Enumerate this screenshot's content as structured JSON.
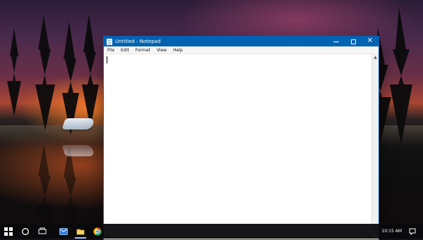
{
  "window": {
    "title": "Untitled - Notepad",
    "controls": {
      "minimize": "–",
      "maximize": "□",
      "close": "✕"
    },
    "menu": [
      "File",
      "Edit",
      "Format",
      "View",
      "Help"
    ],
    "editor_text": ""
  },
  "taskbar": {
    "clock_time": "10:15 AM",
    "apps": [
      {
        "name": "start",
        "icon": "windows-icon"
      },
      {
        "name": "search",
        "icon": "search-icon"
      },
      {
        "name": "task-view",
        "icon": "task-view-icon"
      },
      {
        "name": "mail",
        "icon": "mail-icon"
      },
      {
        "name": "file-explorer",
        "icon": "folder-icon"
      },
      {
        "name": "chrome",
        "icon": "chrome-icon"
      }
    ]
  },
  "colors": {
    "titlebar": "#0063b1",
    "taskbar": "#0a0a0c",
    "accent_indicator": "#9bc5ff"
  }
}
